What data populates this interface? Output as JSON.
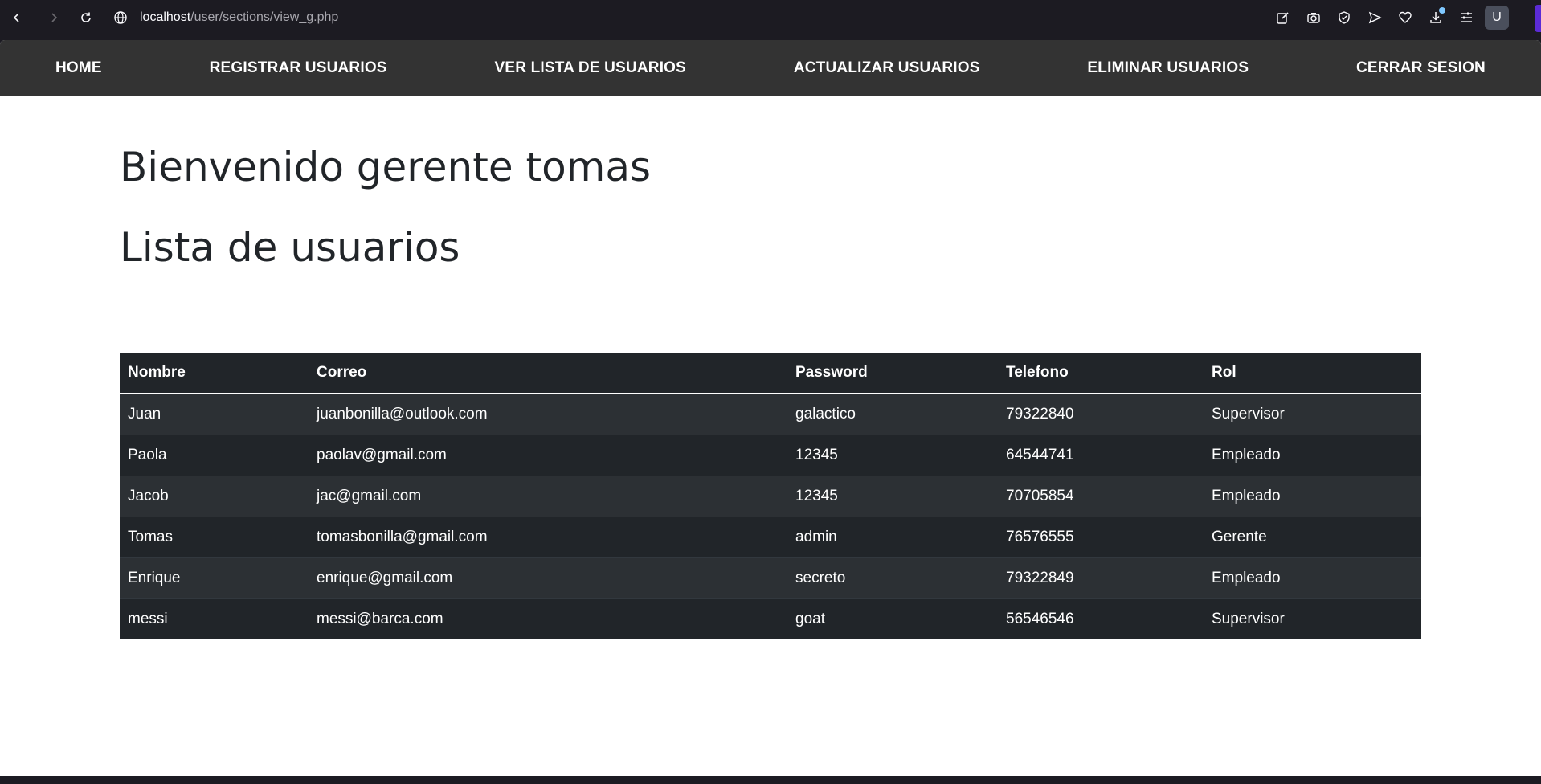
{
  "browser": {
    "url_host": "localhost",
    "url_path": "/user/sections/view_g.php",
    "profile_initial": "U"
  },
  "nav": {
    "items": [
      {
        "label": "HOME"
      },
      {
        "label": "REGISTRAR USUARIOS"
      },
      {
        "label": "VER LISTA DE USUARIOS"
      },
      {
        "label": "ACTUALIZAR USUARIOS"
      },
      {
        "label": "ELIMINAR USUARIOS"
      },
      {
        "label": "CERRAR SESION"
      }
    ]
  },
  "page": {
    "welcome": "Bienvenido gerente tomas",
    "list_title": "Lista de usuarios"
  },
  "table": {
    "headers": [
      "Nombre",
      "Correo",
      "Password",
      "Telefono",
      "Rol"
    ],
    "rows": [
      [
        "Juan",
        "juanbonilla@outlook.com",
        "galactico",
        "79322840",
        "Supervisor"
      ],
      [
        "Paola",
        "paolav@gmail.com",
        "12345",
        "64544741",
        "Empleado"
      ],
      [
        "Jacob",
        "jac@gmail.com",
        "12345",
        "70705854",
        "Empleado"
      ],
      [
        "Tomas",
        "tomasbonilla@gmail.com",
        "admin",
        "76576555",
        "Gerente"
      ],
      [
        "Enrique",
        "enrique@gmail.com",
        "secreto",
        "79322849",
        "Empleado"
      ],
      [
        "messi",
        "messi@barca.com",
        "goat",
        "56546546",
        "Supervisor"
      ]
    ]
  },
  "colors": {
    "nav_bg": "#333333",
    "table_header_bg": "#212529",
    "table_row_odd": "#2c3034",
    "table_row_even": "#212529",
    "browser_bg": "#1c1b22"
  }
}
